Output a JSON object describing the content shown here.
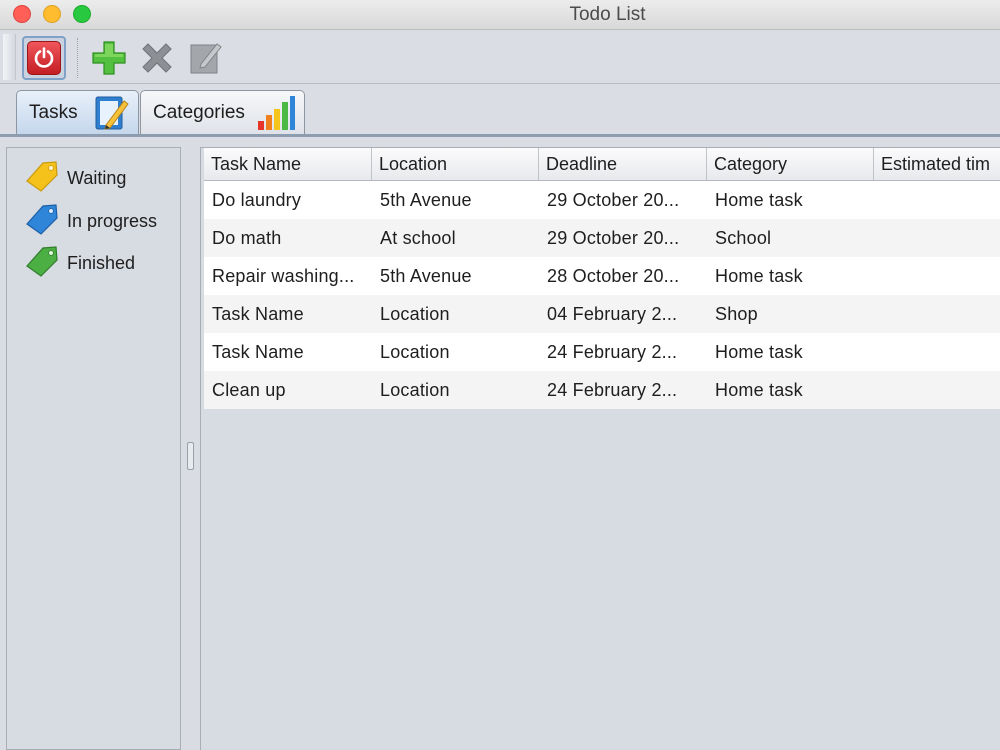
{
  "window": {
    "title": "Todo List"
  },
  "toolbar": {
    "buttons": [
      {
        "name": "power",
        "icon": "power-icon",
        "color": "#d9292f"
      },
      {
        "name": "add",
        "icon": "plus-icon",
        "color": "#4cb83a"
      },
      {
        "name": "delete",
        "icon": "x-icon",
        "color": "#8a8d92"
      },
      {
        "name": "edit",
        "icon": "edit-icon",
        "color": "#8a8d92"
      }
    ]
  },
  "tabs": [
    {
      "label": "Tasks",
      "icon": "notepad-pencil-icon",
      "selected": true
    },
    {
      "label": "Categories",
      "icon": "bar-chart-icon",
      "selected": false
    }
  ],
  "statuses": [
    {
      "label": "Waiting",
      "icon": "yellow-tag-icon",
      "color": "#f4c21b"
    },
    {
      "label": "In progress",
      "icon": "blue-tag-icon",
      "color": "#2f86d8"
    },
    {
      "label": "Finished",
      "icon": "green-tag-icon",
      "color": "#4caf44"
    }
  ],
  "table": {
    "columns": [
      "Task Name",
      "Location",
      "Deadline",
      "Category",
      "Estimated tim"
    ],
    "rows": [
      [
        "Do laundry",
        "5th Avenue",
        "29 October 20...",
        "Home task",
        ""
      ],
      [
        "Do math",
        "At school",
        "29 October 20...",
        "School",
        ""
      ],
      [
        "Repair washing...",
        "5th Avenue",
        "28 October 20...",
        "Home task",
        ""
      ],
      [
        "Task Name",
        "Location",
        "04 February 2...",
        "Shop",
        ""
      ],
      [
        "Task Name",
        "Location",
        "24 February 2...",
        "Home task",
        ""
      ],
      [
        "Clean up",
        "Location",
        "24 February 2...",
        "Home task",
        ""
      ]
    ]
  }
}
